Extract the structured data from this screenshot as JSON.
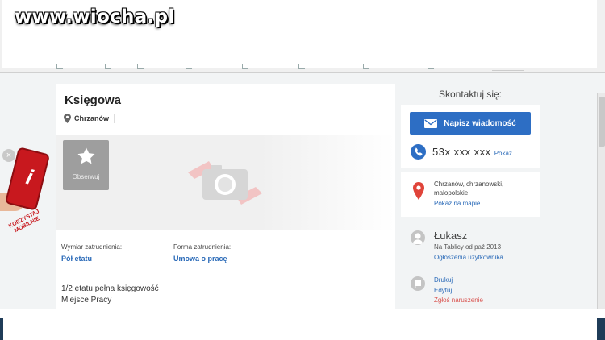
{
  "watermark": "www.wiocha.pl",
  "listing": {
    "title": "Księgowa",
    "location": "Chrzanów",
    "follow_label": "Obserwuj",
    "employment_type": {
      "label": "Wymiar zatrudnienia:",
      "value": "Pół etatu"
    },
    "contract_type": {
      "label": "Forma zatrudnienia:",
      "value": "Umowa o pracę"
    },
    "description_lines": [
      "1/2 etatu pełna księgowość",
      "Miejsce Pracy"
    ]
  },
  "sidebar": {
    "contact_title": "Skontaktuj się:",
    "message_button": "Napisz wiadomość",
    "phone": "53x xxx xxx",
    "phone_show": "Pokaż",
    "address": "Chrzanów, chrzanowski, małopolskie",
    "map_link": "Pokaż na mapie",
    "user_name": "Łukasz",
    "user_since": "Na Tablicy od paź 2013",
    "user_ads_link": "Ogłoszenia użytkownika",
    "actions": {
      "print": "Drukuj",
      "edit": "Edytuj",
      "report": "Zgłoś naruszenie"
    }
  },
  "promo": {
    "text": "KORZYSTAJ MOBILNIE"
  },
  "icons": [
    "close-icon",
    "pin-icon",
    "star-icon",
    "camera-placeholder-icon",
    "mail-icon",
    "phone-icon",
    "map-pin-icon",
    "avatar-icon",
    "flag-icon"
  ],
  "colors": {
    "accent_blue": "#2d6ec4",
    "link_blue": "#2a6ab8",
    "report_red": "#d9534f",
    "promo_red": "#c8181e",
    "map_pin_red": "#e0443a"
  }
}
